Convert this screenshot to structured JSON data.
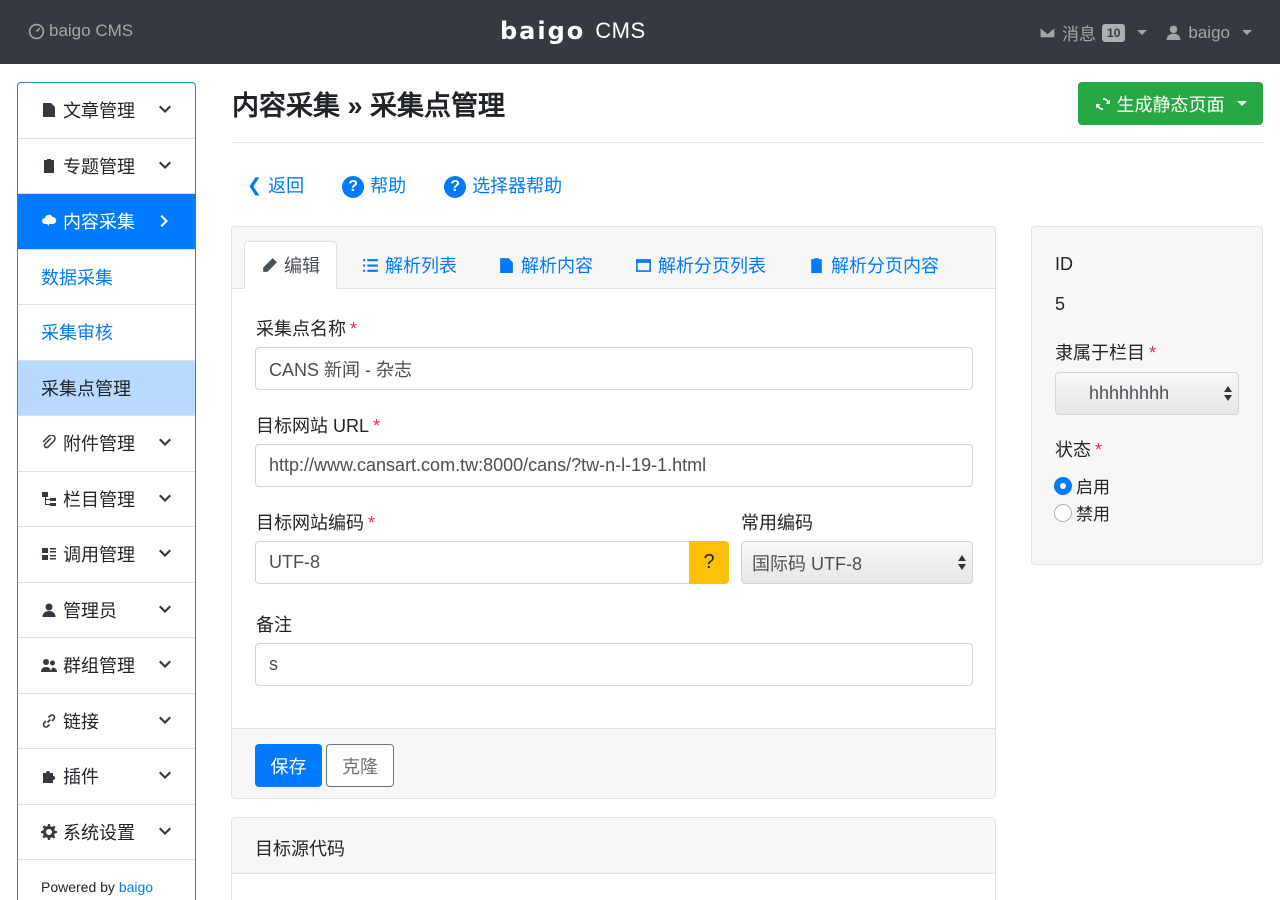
{
  "topbar": {
    "left_label": "baigo CMS",
    "brand_logo": "baigo",
    "brand_text": "CMS",
    "messages_label": "消息",
    "messages_count": "10",
    "user_label": "baigo"
  },
  "sidebar": {
    "items": [
      {
        "label": "文章管理"
      },
      {
        "label": "专题管理"
      },
      {
        "label": "内容采集"
      },
      {
        "label": "数据采集"
      },
      {
        "label": "采集审核"
      },
      {
        "label": "采集点管理"
      },
      {
        "label": "附件管理"
      },
      {
        "label": "栏目管理"
      },
      {
        "label": "调用管理"
      },
      {
        "label": "管理员"
      },
      {
        "label": "群组管理"
      },
      {
        "label": "链接"
      },
      {
        "label": "插件"
      },
      {
        "label": "系统设置"
      }
    ],
    "footer_prefix": "Powered by",
    "footer_link": "baigo"
  },
  "header": {
    "title": "内容采集 » 采集点管理",
    "generate_button": "生成静态页面"
  },
  "links": {
    "back": "返回",
    "help": "帮助",
    "selector_help": "选择器帮助"
  },
  "tabs": [
    "编辑",
    "解析列表",
    "解析内容",
    "解析分页列表",
    "解析分页内容"
  ],
  "form": {
    "name_label": "采集点名称",
    "name_value": "CANS 新闻 - 杂志",
    "url_label": "目标网站 URL",
    "url_value": "http://www.cansart.com.tw:8000/cans/?tw-n-l-19-1.html",
    "charset_label": "目标网站编码",
    "charset_value": "UTF-8",
    "charset_help": "?",
    "common_charset_label": "常用编码",
    "common_charset_value": "国际码 UTF-8",
    "note_label": "备注",
    "note_value": "s",
    "required_mark": "*"
  },
  "footer": {
    "save": "保存",
    "clone": "克隆"
  },
  "source_card": {
    "title": "目标源代码"
  },
  "right_panel": {
    "id_label": "ID",
    "id_value": "5",
    "category_label": "隶属于栏目",
    "category_value": "hhhhhhhh",
    "status_label": "状态",
    "status_options": [
      "启用",
      "禁用"
    ],
    "status_selected": "启用"
  },
  "colors": {
    "navbar": "#343a40",
    "primary": "#007bff",
    "success": "#28a745",
    "warning": "#ffc107",
    "danger": "#dc3545"
  }
}
